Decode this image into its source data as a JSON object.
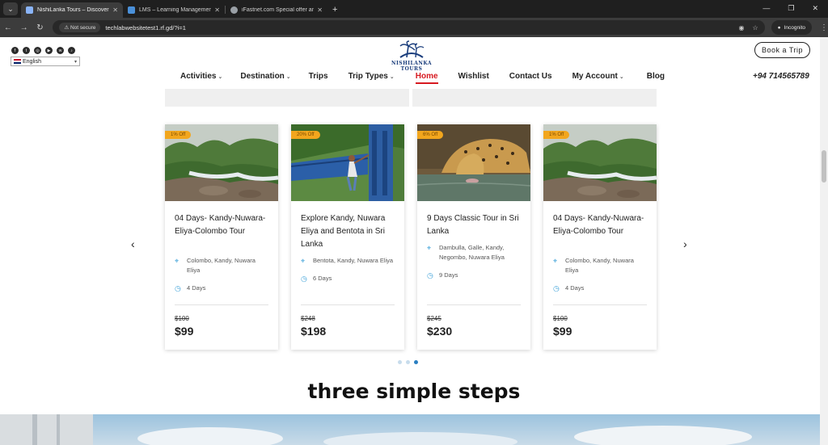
{
  "browser": {
    "tabs": [
      {
        "title": "NishiLanka Tours – Discover Sri",
        "active": true,
        "favicon_color": "#8ab4f8"
      },
      {
        "title": "LMS – Learning Management ..",
        "active": false,
        "favicon_color": "#4a90d9"
      },
      {
        "title": "iFastnet.com Special offer and I",
        "active": false,
        "favicon_color": "#9aa0a6"
      }
    ],
    "new_tab": "+",
    "not_secure": "Not secure",
    "url": "techlabwebsitetest1.rf.gd/?i=1",
    "incognito": "Incognito"
  },
  "header": {
    "socials": [
      "facebook-icon",
      "twitter-icon",
      "instagram-icon",
      "youtube-icon",
      "whatsapp-icon",
      "tiktok-icon"
    ],
    "language": "English",
    "logo_text": "NISHILANKA TOURS",
    "book_button": "Book a Trip",
    "phone": "+94 714565789",
    "nav": [
      {
        "label": "Activities",
        "dropdown": true,
        "active": false
      },
      {
        "label": "Destination",
        "dropdown": true,
        "active": false
      },
      {
        "label": "Trips",
        "dropdown": false,
        "active": false
      },
      {
        "label": "Trip Types",
        "dropdown": true,
        "active": false
      },
      {
        "label": "Home",
        "dropdown": false,
        "active": true
      },
      {
        "label": "Wishlist",
        "dropdown": false,
        "active": false
      },
      {
        "label": "Contact Us",
        "dropdown": false,
        "active": false
      },
      {
        "label": "My Account",
        "dropdown": true,
        "active": false
      },
      {
        "label": "Blog",
        "dropdown": false,
        "active": false
      }
    ],
    "accent_color": "#d71920"
  },
  "carousel": {
    "prev": "‹",
    "next": "›",
    "cards": [
      {
        "badge": "1% Off",
        "title": "04 Days- Kandy-Nuwara-Eliya-Colombo Tour",
        "locations": "Colombo, Kandy, Nuwara Eliya",
        "duration": "4 Days",
        "old_price": "$100",
        "price": "$99",
        "image": "waterfall-forest"
      },
      {
        "badge": "20% Off",
        "title": "Explore Kandy, Nuwara Eliya and Bentota in Sri Lanka",
        "locations": "Bentota, Kandy, Nuwara Eliya",
        "duration": "6 Days",
        "old_price": "$248",
        "price": "$198",
        "image": "blue-train"
      },
      {
        "badge": "6% Off",
        "title": "9 Days Classic Tour in Sri Lanka",
        "locations": "Dambulla, Galle, Kandy, Negombo, Nuwara Eliya",
        "duration": "9 Days",
        "old_price": "$245",
        "price": "$230",
        "image": "leopard-drinking"
      },
      {
        "badge": "1% Off",
        "title": "04 Days- Kandy-Nuwara-Eliya-Colombo Tour",
        "locations": "Colombo, Kandy, Nuwara Eliya",
        "duration": "4 Days",
        "old_price": "$100",
        "price": "$99",
        "image": "waterfall-forest"
      }
    ],
    "active_page": 3,
    "page_count": 3
  },
  "section_heading": "three simple steps"
}
